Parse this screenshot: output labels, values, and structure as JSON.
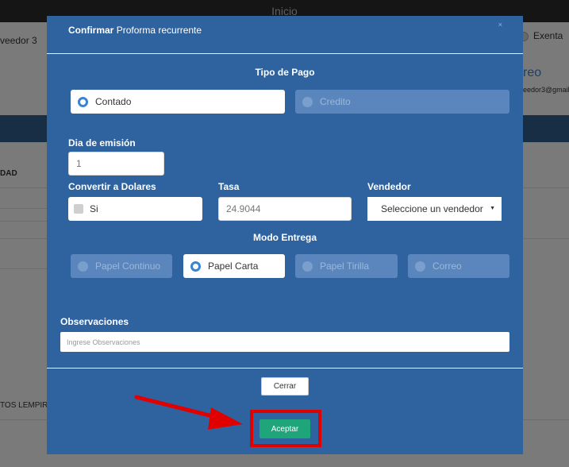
{
  "background": {
    "window_title": "Inicio",
    "customer_name_fragment": "veedor 3",
    "exempt_label": "Exenta",
    "email_heading_fragment": "reo",
    "email_fragment": "eedor3@gmail.",
    "column_fragment": "DAD",
    "total_fragment": "TOS LEMPIRA"
  },
  "modal": {
    "title_bold": "Confirmar",
    "title_rest": "Proforma recurrente",
    "close_glyph": "×",
    "payment_type": {
      "title": "Tipo de Pago",
      "options": [
        {
          "label": "Contado",
          "selected": true
        },
        {
          "label": "Credito",
          "selected": false
        }
      ]
    },
    "issue_day": {
      "label": "Dia de emisión",
      "value": "1"
    },
    "convert": {
      "label": "Convertir a Dolares",
      "checkbox_label": "Si",
      "checked": false
    },
    "rate": {
      "label": "Tasa",
      "value": "24.9044"
    },
    "seller": {
      "label": "Vendedor",
      "selected": "Seleccione un vendedor"
    },
    "delivery_mode": {
      "title": "Modo Entrega",
      "options": [
        {
          "label": "Papel Continuo",
          "selected": false
        },
        {
          "label": "Papel Carta",
          "selected": true
        },
        {
          "label": "Papel Tirilla",
          "selected": false
        },
        {
          "label": "Correo",
          "selected": false
        }
      ]
    },
    "observations": {
      "label": "Observaciones",
      "placeholder": "Ingrese Observaciones"
    },
    "buttons": {
      "close": "Cerrar",
      "accept": "Aceptar"
    }
  },
  "colors": {
    "modal_bg": "#2f63a0",
    "accept_button": "#1fa57a",
    "highlight": "#e00000",
    "header_band": "#2e5c8a"
  }
}
